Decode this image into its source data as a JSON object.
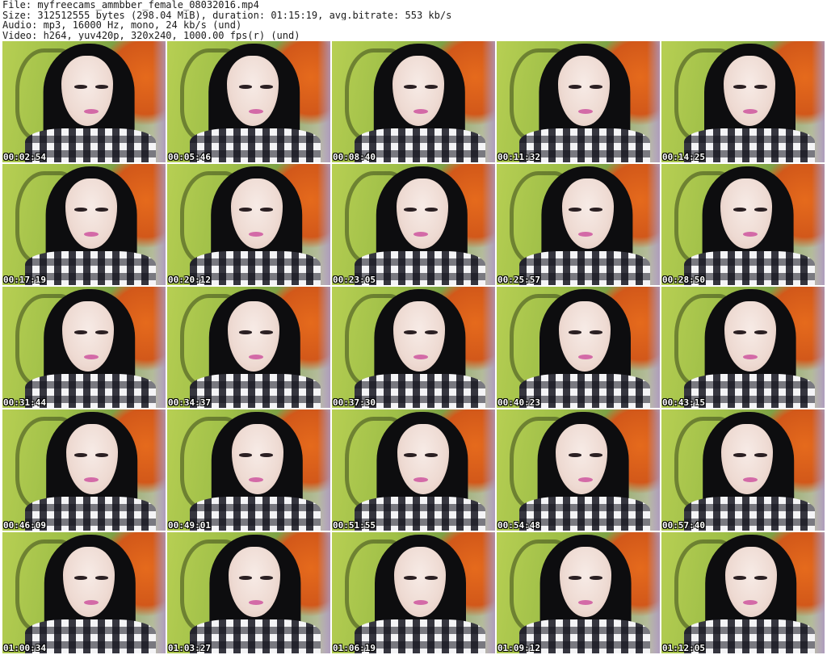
{
  "header": {
    "file": "File: myfreecams_ammbber_female_08032016.mp4",
    "size": "Size: 312512555 bytes (298.04 MiB), duration: 01:15:19, avg.bitrate: 553 kb/s",
    "audio": "Audio: mp3, 16000 Hz, mono, 24 kb/s (und)",
    "video": "Video: h264, yuv420p, 320x240, 1000.00 fps(r) (und)"
  },
  "thumbnails": [
    {
      "timestamp": "00:02:54"
    },
    {
      "timestamp": "00:05:46"
    },
    {
      "timestamp": "00:08:40"
    },
    {
      "timestamp": "00:11:32"
    },
    {
      "timestamp": "00:14:25"
    },
    {
      "timestamp": "00:17:19"
    },
    {
      "timestamp": "00:20:12"
    },
    {
      "timestamp": "00:23:05"
    },
    {
      "timestamp": "00:25:57"
    },
    {
      "timestamp": "00:28:50"
    },
    {
      "timestamp": "00:31:44"
    },
    {
      "timestamp": "00:34:37"
    },
    {
      "timestamp": "00:37:30"
    },
    {
      "timestamp": "00:40:23"
    },
    {
      "timestamp": "00:43:15"
    },
    {
      "timestamp": "00:46:09"
    },
    {
      "timestamp": "00:49:01"
    },
    {
      "timestamp": "00:51:55"
    },
    {
      "timestamp": "00:54:48"
    },
    {
      "timestamp": "00:57:40"
    },
    {
      "timestamp": "01:00:34"
    },
    {
      "timestamp": "01:03:27"
    },
    {
      "timestamp": "01:06:19"
    },
    {
      "timestamp": "01:09:12"
    },
    {
      "timestamp": "01:12:05"
    }
  ]
}
